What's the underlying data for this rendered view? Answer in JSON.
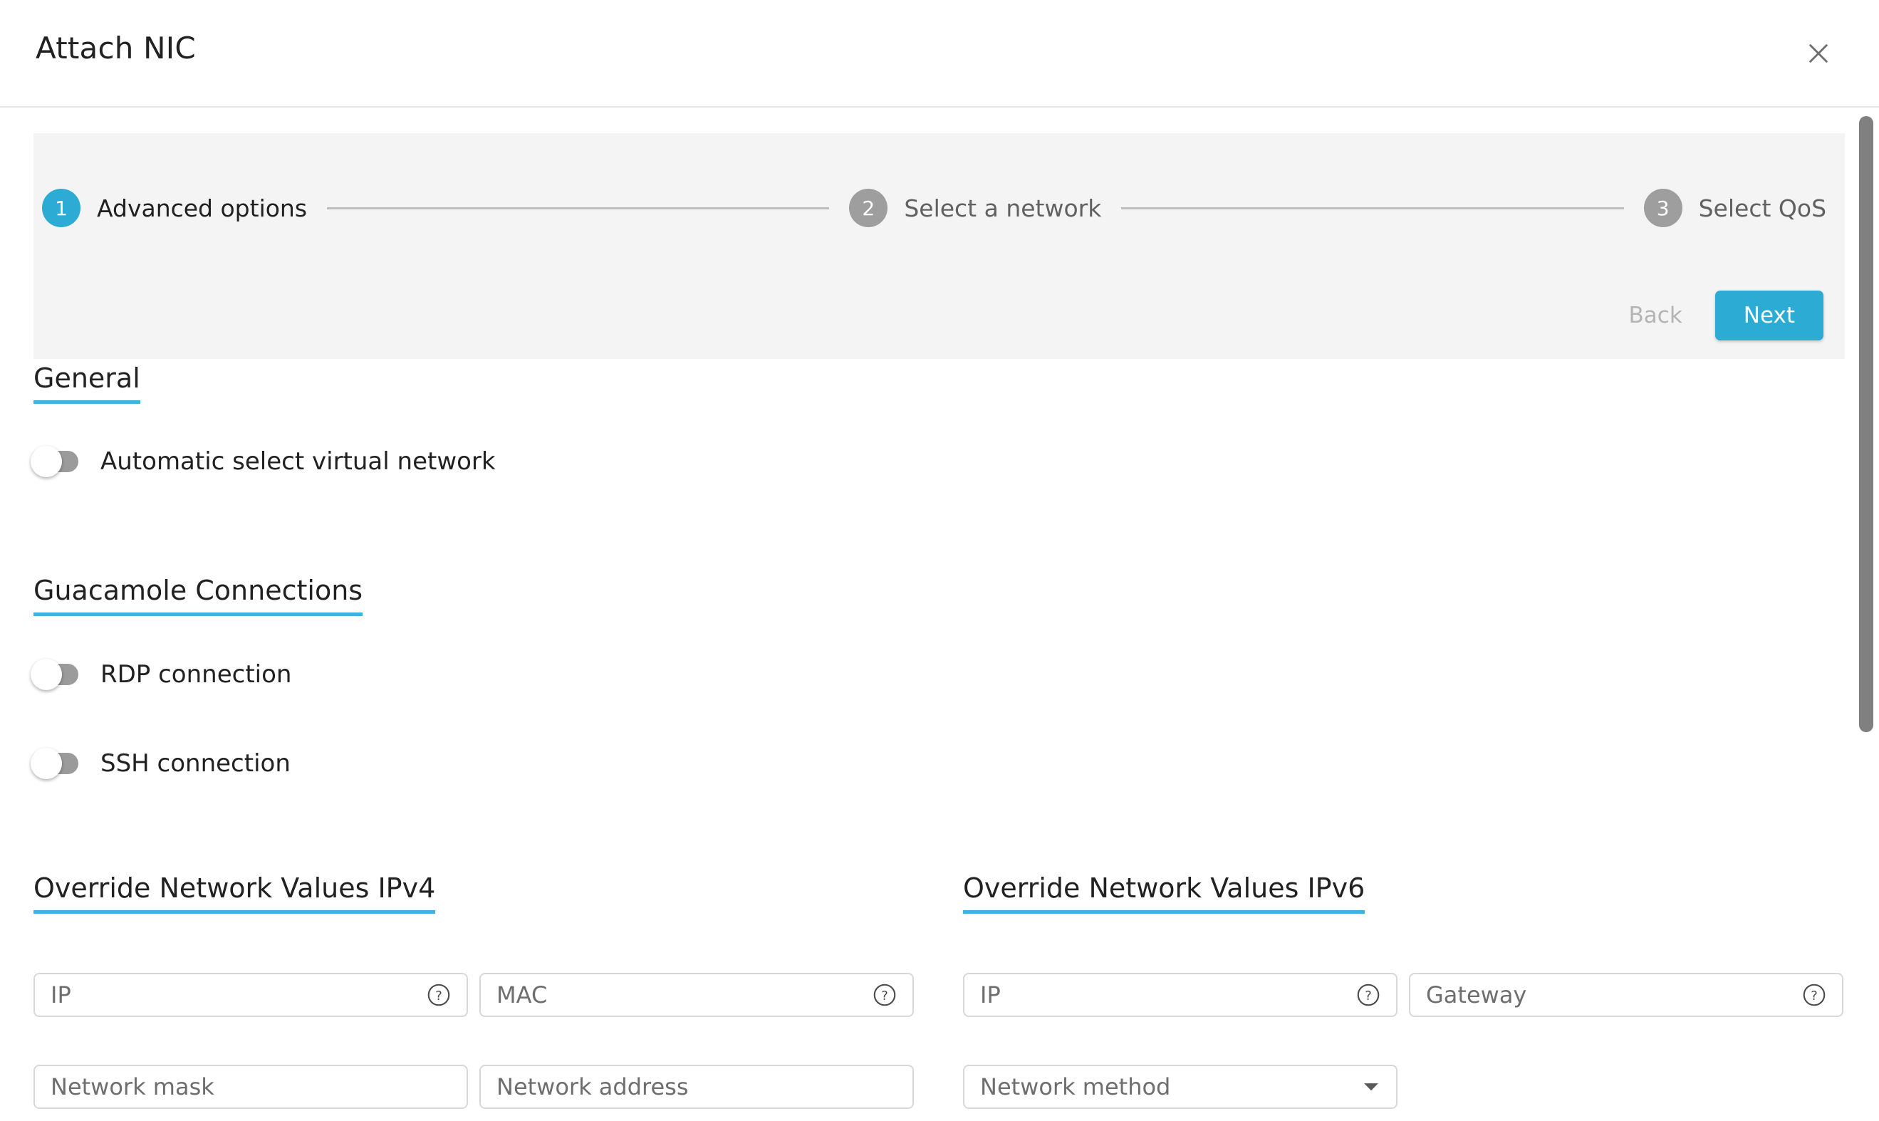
{
  "dialog": {
    "title": "Attach NIC",
    "close_icon": "close-icon"
  },
  "stepper": {
    "steps": [
      {
        "number": "1",
        "label": "Advanced options",
        "state": "active"
      },
      {
        "number": "2",
        "label": "Select a network",
        "state": "inactive"
      },
      {
        "number": "3",
        "label": "Select QoS",
        "state": "inactive"
      }
    ],
    "back_label": "Back",
    "next_label": "Next",
    "accent_color": "#2cacd4",
    "panel_bg": "#f4f4f4",
    "back_color": "#b4b4b4"
  },
  "sections": {
    "general": {
      "title": "General",
      "toggles": [
        {
          "label": "Automatic select virtual network",
          "on": false
        }
      ]
    },
    "guacamole": {
      "title": "Guacamole Connections",
      "toggles": [
        {
          "label": "RDP connection",
          "on": false
        },
        {
          "label": "SSH connection",
          "on": false
        }
      ]
    },
    "ipv4": {
      "title": "Override Network Values IPv4",
      "fields": [
        {
          "placeholder": "IP",
          "value": "",
          "help": true,
          "type": "text"
        },
        {
          "placeholder": "MAC",
          "value": "",
          "help": true,
          "type": "text"
        },
        {
          "placeholder": "Network mask",
          "value": "",
          "help": false,
          "type": "text"
        },
        {
          "placeholder": "Network address",
          "value": "",
          "help": false,
          "type": "text"
        }
      ]
    },
    "ipv6": {
      "title": "Override Network Values IPv6",
      "fields": [
        {
          "placeholder": "IP",
          "value": "",
          "help": true,
          "type": "text"
        },
        {
          "placeholder": "Gateway",
          "value": "",
          "help": true,
          "type": "text"
        },
        {
          "placeholder": "Network method",
          "value": "",
          "help": false,
          "type": "select"
        }
      ]
    }
  },
  "underline_color": "#3cb4dc",
  "scrollbar": {
    "thumb_color": "#808080"
  }
}
